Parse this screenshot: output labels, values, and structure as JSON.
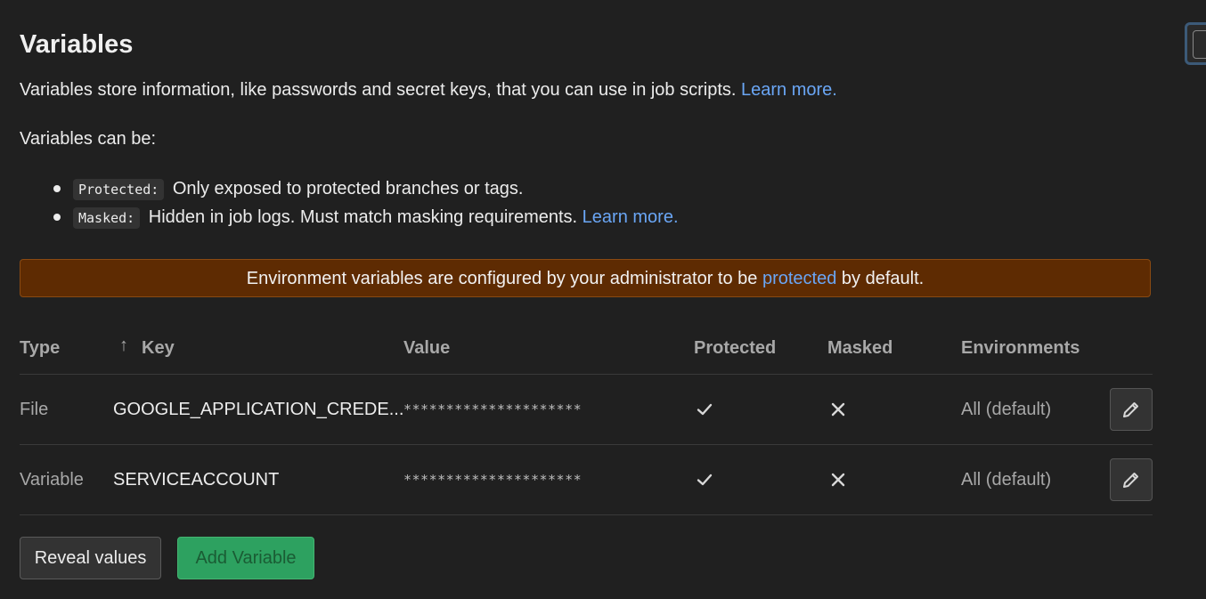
{
  "header": {
    "title": "Variables",
    "description": "Variables store information, like passwords and secret keys, that you can use in job scripts.",
    "learn_more": "Learn more."
  },
  "can_be": {
    "intro": "Variables can be:",
    "items": [
      {
        "code": "Protected:",
        "text": "Only exposed to protected branches or tags.",
        "link": ""
      },
      {
        "code": "Masked:",
        "text": "Hidden in job logs. Must match masking requirements.",
        "link": "Learn more."
      }
    ]
  },
  "alert": {
    "before": "Environment variables are configured by your administrator to be",
    "link": "protected",
    "after": "by default."
  },
  "table": {
    "columns": {
      "type": "Type",
      "key_arrow": "↑",
      "key": "Key",
      "value": "Value",
      "protected": "Protected",
      "masked": "Masked",
      "environments": "Environments"
    },
    "rows": [
      {
        "type": "File",
        "key": "GOOGLE_APPLICATION_CREDE...",
        "value": "*********************",
        "protected": true,
        "masked": false,
        "environment": "All (default)"
      },
      {
        "type": "Variable",
        "key": "SERVICEACCOUNT",
        "value": "*********************",
        "protected": true,
        "masked": false,
        "environment": "All (default)"
      }
    ]
  },
  "actions": {
    "reveal": "Reveal values",
    "add": "Add Variable"
  },
  "icons": {
    "protected": "check-icon",
    "masked": "close-icon",
    "edit": "pencil-icon"
  },
  "colors": {
    "link": "#6aa6f5",
    "alert_bg": "#5e2b02",
    "add_button": "#2da160"
  }
}
